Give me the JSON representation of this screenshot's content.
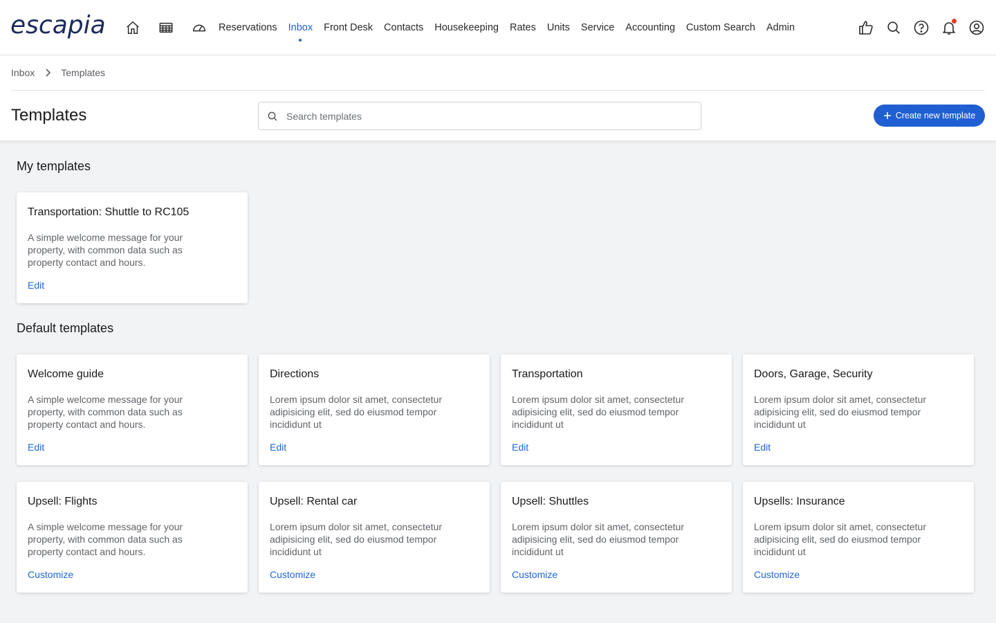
{
  "brand": {
    "logo_text": "escapia",
    "color": "#1c2a5c",
    "accent": "#1f5fd1"
  },
  "nav": {
    "icons": [
      "home-icon",
      "calendar-grid-icon",
      "dashboard-gauge-icon"
    ],
    "links": [
      {
        "label": "Reservations",
        "active": false
      },
      {
        "label": "Inbox",
        "active": true
      },
      {
        "label": "Front Desk",
        "active": false
      },
      {
        "label": "Contacts",
        "active": false
      },
      {
        "label": "Housekeeping",
        "active": false
      },
      {
        "label": "Rates",
        "active": false
      },
      {
        "label": "Units",
        "active": false
      },
      {
        "label": "Service",
        "active": false
      },
      {
        "label": "Accounting",
        "active": false
      },
      {
        "label": "Custom Search",
        "active": false
      },
      {
        "label": "Admin",
        "active": false
      }
    ],
    "right_icons": [
      "thumbs-up-icon",
      "search-icon",
      "help-icon",
      "bell-icon",
      "user-account-icon"
    ]
  },
  "breadcrumb": {
    "items": [
      "Inbox",
      "Templates"
    ]
  },
  "page": {
    "title": "Templates",
    "search_placeholder": "Search templates",
    "create_button": "Create new template"
  },
  "my_templates": {
    "title": "My templates",
    "cards": [
      {
        "title": "Transportation: Shuttle to RC105",
        "desc": "A simple welcome message for your property, with common data such as property contact and hours.",
        "action": "Edit"
      }
    ]
  },
  "default_templates": {
    "title": "Default templates",
    "cards": [
      {
        "title": "Welcome guide",
        "desc": "A simple welcome message for your property, with common data such as property contact and hours.",
        "action": "Edit"
      },
      {
        "title": "Directions",
        "desc": "Lorem ipsum dolor sit amet, consectetur adipisicing elit, sed do eiusmod tempor incididunt ut",
        "action": "Edit"
      },
      {
        "title": "Transportation",
        "desc": "Lorem ipsum dolor sit amet, consectetur adipisicing elit, sed do eiusmod tempor incididunt ut",
        "action": "Edit"
      },
      {
        "title": "Doors, Garage, Security",
        "desc": "Lorem ipsum dolor sit amet, consectetur adipisicing elit, sed do eiusmod tempor incididunt ut",
        "action": "Edit"
      },
      {
        "title": "Upsell: Flights",
        "desc": "A simple welcome message for your property, with common data such as property contact and hours.",
        "action": "Customize"
      },
      {
        "title": "Upsell: Rental car",
        "desc": "Lorem ipsum dolor sit amet, consectetur adipisicing elit, sed do eiusmod tempor incididunt ut",
        "action": "Customize"
      },
      {
        "title": "Upsell: Shuttles",
        "desc": "Lorem ipsum dolor sit amet, consectetur adipisicing elit, sed do eiusmod tempor incididunt ut",
        "action": "Customize"
      },
      {
        "title": "Upsells: Insurance",
        "desc": "Lorem ipsum dolor sit amet, consectetur adipisicing elit, sed do eiusmod tempor incididunt ut",
        "action": "Customize"
      }
    ]
  }
}
